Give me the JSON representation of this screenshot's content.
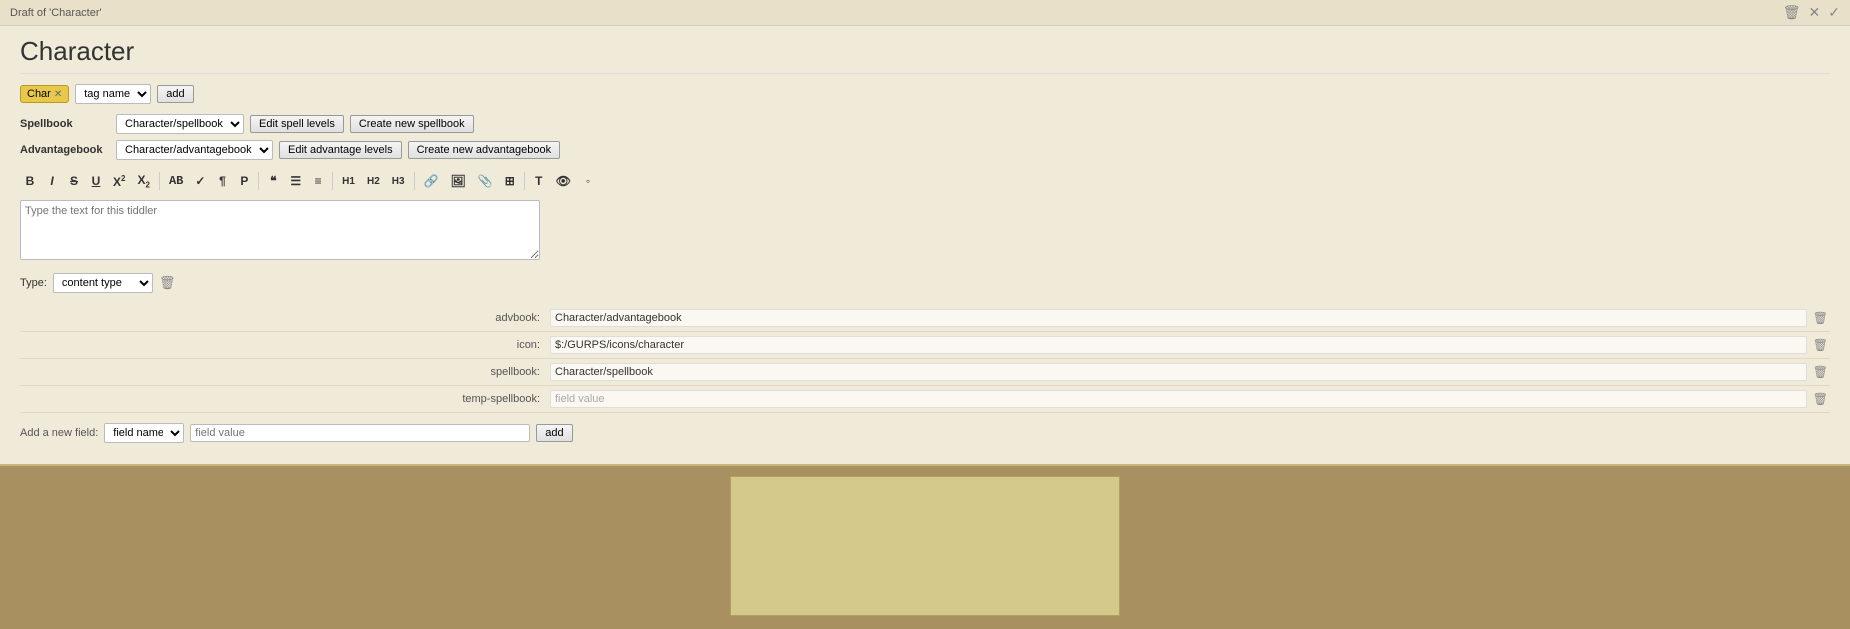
{
  "draft_label": "Draft of 'Character'",
  "top_actions": {
    "delete_label": "🗑",
    "close_label": "✕",
    "confirm_label": "✓"
  },
  "page_title": "Character",
  "tags": {
    "existing_tag": "Char",
    "tag_input_placeholder": "tag name",
    "add_button": "add"
  },
  "spellbook": {
    "label": "Spellbook",
    "select_value": "Character/spellbook",
    "options": [
      "Character/spellbook"
    ],
    "edit_button": "Edit spell levels",
    "create_button": "Create new spellbook"
  },
  "advantagebook": {
    "label": "Advantagebook",
    "select_value": "Character/advantagebook",
    "options": [
      "Character/advantagebook"
    ],
    "edit_button": "Edit advantage levels",
    "create_button": "Create new advantagebook"
  },
  "toolbar": {
    "buttons": [
      {
        "name": "bold",
        "label": "B",
        "style": "bold"
      },
      {
        "name": "italic",
        "label": "I",
        "style": "italic"
      },
      {
        "name": "strikethrough",
        "label": "S",
        "style": "strike"
      },
      {
        "name": "underline",
        "label": "U",
        "style": "underline"
      },
      {
        "name": "superscript",
        "label": "X²"
      },
      {
        "name": "subscript",
        "label": "X₂"
      },
      {
        "name": "monospace",
        "label": "AB"
      },
      {
        "name": "format1",
        "label": "✓"
      },
      {
        "name": "format2",
        "label": "¶"
      },
      {
        "name": "format3",
        "label": "Ρ"
      },
      {
        "name": "quote",
        "label": "❝"
      },
      {
        "name": "list-unordered",
        "label": "☰"
      },
      {
        "name": "list-ordered",
        "label": "≡"
      },
      {
        "name": "h1",
        "label": "H1"
      },
      {
        "name": "h2",
        "label": "H2"
      },
      {
        "name": "h3",
        "label": "H3"
      },
      {
        "name": "link",
        "label": "🔗"
      },
      {
        "name": "image",
        "label": "🖼"
      },
      {
        "name": "insert",
        "label": "📎"
      },
      {
        "name": "table",
        "label": "⊞"
      },
      {
        "name": "text-color",
        "label": "T"
      },
      {
        "name": "visibility",
        "label": "👁"
      },
      {
        "name": "more",
        "label": "◦"
      }
    ]
  },
  "textarea": {
    "placeholder": "Type the text for this tiddler"
  },
  "type_field": {
    "label": "Type:",
    "placeholder": "content type"
  },
  "fields": [
    {
      "name": "advbook",
      "value": "Character/advantagebook"
    },
    {
      "name": "icon",
      "value": "$:/GURPS/icons/character"
    },
    {
      "name": "spellbook",
      "value": "Character/spellbook"
    },
    {
      "name": "temp-spellbook",
      "value": "field value"
    }
  ],
  "add_field": {
    "label": "Add a new field:",
    "name_placeholder": "field name",
    "value_placeholder": "field value",
    "add_button": "add"
  }
}
